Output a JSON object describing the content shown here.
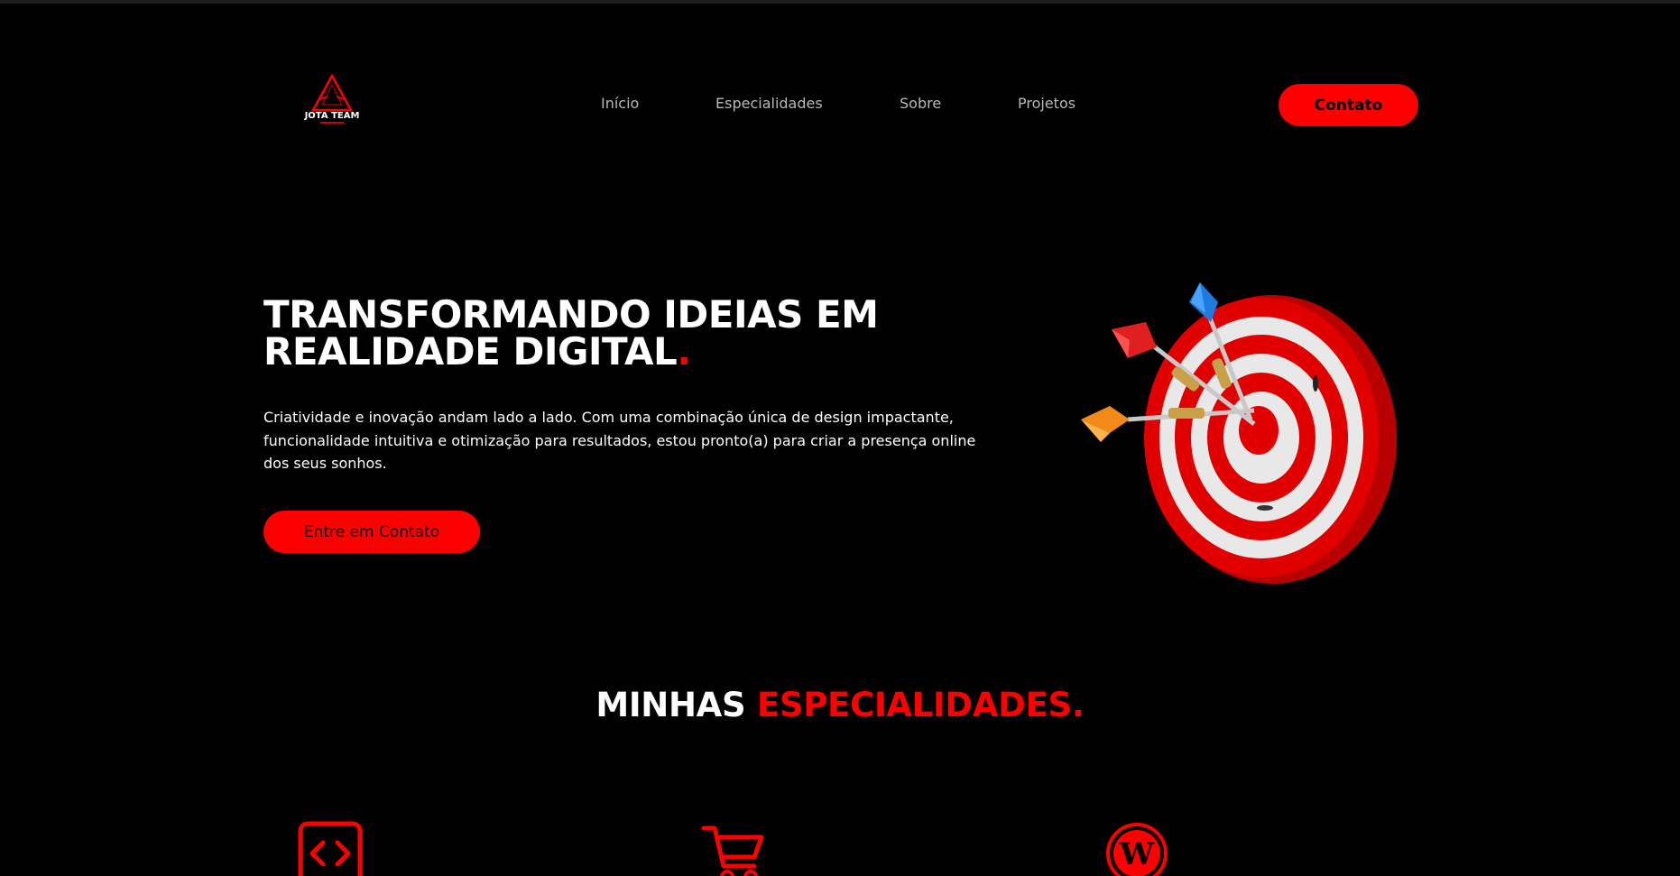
{
  "brand": {
    "logo_text": "JOTA TEAM",
    "accent_color": "#ff0000"
  },
  "nav": {
    "items": [
      {
        "label": "Início"
      },
      {
        "label": "Especialidades"
      },
      {
        "label": "Sobre"
      },
      {
        "label": "Projetos"
      }
    ],
    "contact_label": "Contato"
  },
  "hero": {
    "title_line1": "TRANSFORMANDO IDEIAS EM",
    "title_line2": "REALIDADE DIGITAL",
    "title_dot": ".",
    "description": "Criatividade e inovação andam lado a lado. Com uma combinação única de design impactante, funcionalidade intuitiva e otimização para resultados, estou pronto(a) para criar a presença online dos seus sonhos.",
    "cta_label": "Entre em Contato",
    "image": "dartboard-target-illustration"
  },
  "specialties": {
    "title_white": "MINHAS ",
    "title_red": "ESPECIALIDADES.",
    "icons": [
      "code-icon",
      "shopping-cart-icon",
      "wordpress-icon"
    ]
  }
}
